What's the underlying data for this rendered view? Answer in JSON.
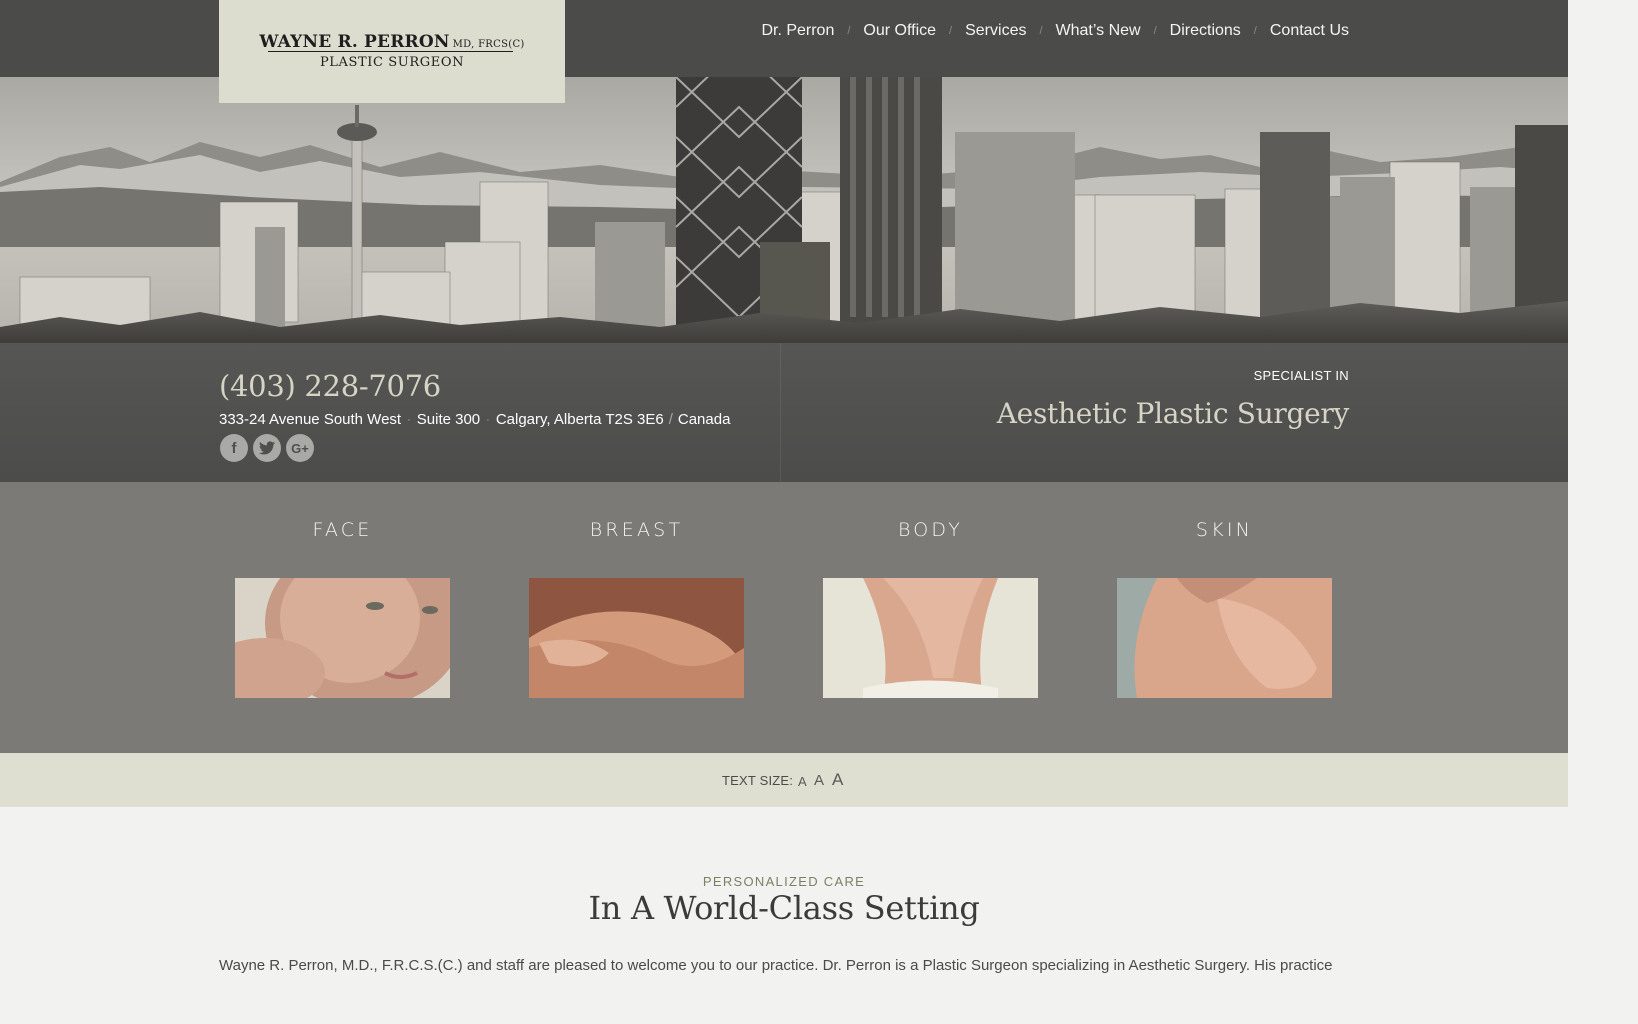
{
  "logo": {
    "name": "WAYNE R. PERRON",
    "credentials": "MD, FRCS(C)",
    "title": "PLASTIC SURGEON"
  },
  "nav": {
    "items": [
      {
        "label": "Dr. Perron"
      },
      {
        "label": "Our Office"
      },
      {
        "label": "Services"
      },
      {
        "label": "What’s New"
      },
      {
        "label": "Directions"
      },
      {
        "label": "Contact Us"
      }
    ],
    "separator": "/"
  },
  "contact": {
    "phone": "(403) 228-7076",
    "street": "333-24 Avenue South West",
    "suite": "Suite 300",
    "city": "Calgary, Alberta T2S 3E6",
    "country": "Canada",
    "social": [
      {
        "icon": "facebook-icon",
        "glyph": "f"
      },
      {
        "icon": "twitter-icon",
        "glyph": "t"
      },
      {
        "icon": "google-plus-icon",
        "glyph": "G+"
      }
    ]
  },
  "specialty": {
    "label": "SPECIALIST IN",
    "title": "Aesthetic Plastic Surgery"
  },
  "categories": [
    {
      "label": "FACE"
    },
    {
      "label": "BREAST"
    },
    {
      "label": "BODY"
    },
    {
      "label": "SKIN"
    }
  ],
  "text_size": {
    "label": "TEXT SIZE:",
    "options": [
      "A",
      "A",
      "A"
    ]
  },
  "intro": {
    "eyebrow": "PERSONALIZED CARE",
    "headline": "In A World-Class Setting",
    "paragraph": "Wayne R. Perron, M.D., F.R.C.S.(C.) and staff are pleased to welcome you to our practice. Dr. Perron is a Plastic Surgeon specializing in Aesthetic Surgery. His practice"
  },
  "colors": {
    "topbar": "#4b4b4a",
    "logo_bg": "#dcdccf",
    "info_band": "#4f4f4e",
    "accent_serif": "#d6d4c4",
    "categories_bg": "#7b7a77",
    "text_size_bar": "#dedfd1",
    "eyebrow": "#7e7f62"
  }
}
